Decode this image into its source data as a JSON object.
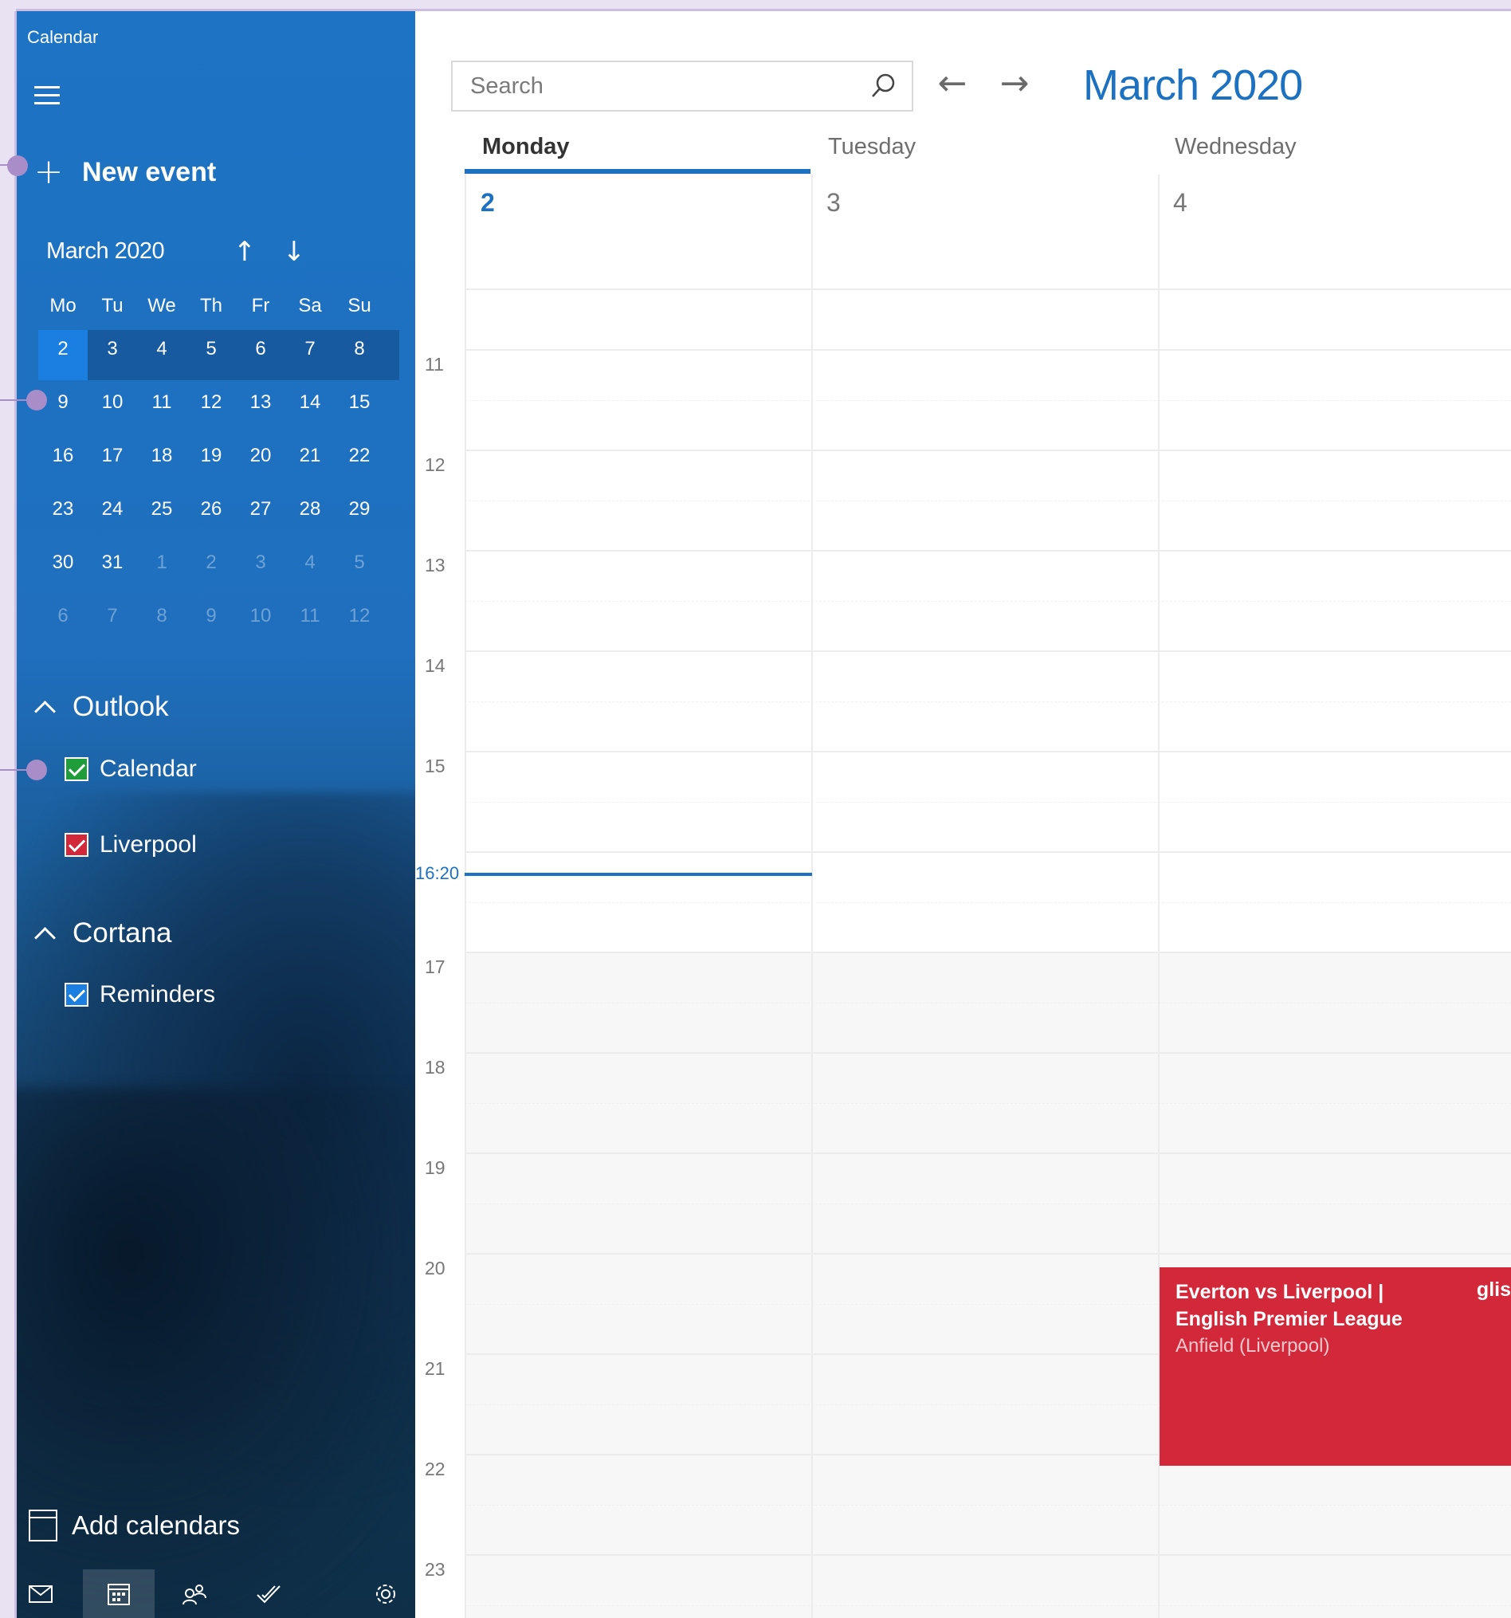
{
  "app": {
    "title": "Calendar"
  },
  "sidebar": {
    "new_event": "New event",
    "mini_calendar": {
      "title": "March 2020",
      "weekdays": [
        "Mo",
        "Tu",
        "We",
        "Th",
        "Fr",
        "Sa",
        "Su"
      ],
      "weeks": [
        [
          "2",
          "3",
          "4",
          "5",
          "6",
          "7",
          "8"
        ],
        [
          "9",
          "10",
          "11",
          "12",
          "13",
          "14",
          "15"
        ],
        [
          "16",
          "17",
          "18",
          "19",
          "20",
          "21",
          "22"
        ],
        [
          "23",
          "24",
          "25",
          "26",
          "27",
          "28",
          "29"
        ],
        [
          "30",
          "31",
          "1",
          "2",
          "3",
          "4",
          "5"
        ],
        [
          "6",
          "7",
          "8",
          "9",
          "10",
          "11",
          "12"
        ]
      ],
      "selected": "2"
    },
    "groups": [
      {
        "label": "Outlook",
        "items": [
          {
            "label": "Calendar",
            "color": "#1f9d3a"
          },
          {
            "label": "Liverpool",
            "color": "#d2283a"
          }
        ]
      },
      {
        "label": "Cortana",
        "items": [
          {
            "label": "Reminders",
            "color": "#1a7fe0"
          }
        ]
      }
    ],
    "add_calendars": "Add calendars"
  },
  "header": {
    "search_placeholder": "Search",
    "title": "March 2020"
  },
  "days": [
    {
      "name": "Monday",
      "num": "2"
    },
    {
      "name": "Tuesday",
      "num": "3"
    },
    {
      "name": "Wednesday",
      "num": "4"
    }
  ],
  "hours": [
    "11",
    "12",
    "13",
    "14",
    "15",
    "",
    "17",
    "18",
    "19",
    "20",
    "21",
    "22",
    "23"
  ],
  "now": "16:20",
  "event": {
    "title": "Everton vs Liverpool | English Premier League",
    "location": "Anfield (Liverpool)",
    "fragment": "glis"
  },
  "colors": {
    "accent": "#1c72c0",
    "event": "#d2283a"
  },
  "bottom_nav": [
    "mail-icon",
    "calendar-icon",
    "people-icon",
    "todo-icon",
    "settings-icon"
  ]
}
